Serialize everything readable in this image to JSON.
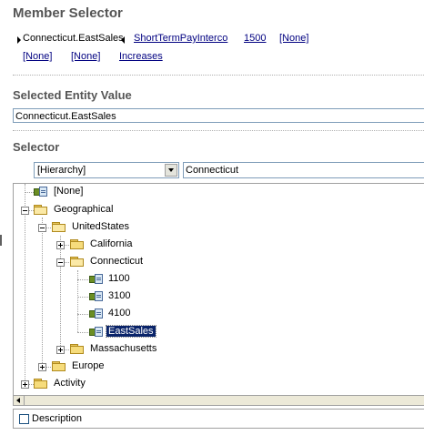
{
  "member_selector": {
    "title": "Member Selector",
    "pov_row1": [
      "Connecticut.EastSales",
      "ShortTermPayInterco",
      "1500",
      "[None]"
    ],
    "pov_row2": [
      "[None]",
      "[None]",
      "Increases"
    ]
  },
  "selected_entity": {
    "title": "Selected Entity Value",
    "value": "Connecticut.EastSales"
  },
  "selector": {
    "title": "Selector",
    "dropdown_value": "[Hierarchy]",
    "search_value": "Connecticut"
  },
  "tree": {
    "nodes": [
      {
        "label": "[None]",
        "type": "member"
      },
      {
        "label": "Geographical",
        "type": "folder-open",
        "state": "expanded"
      },
      {
        "label": "UnitedStates",
        "type": "folder-open",
        "state": "expanded"
      },
      {
        "label": "California",
        "type": "folder",
        "state": "collapsed"
      },
      {
        "label": "Connecticut",
        "type": "folder-open",
        "state": "expanded"
      },
      {
        "label": "1100",
        "type": "member"
      },
      {
        "label": "3100",
        "type": "member"
      },
      {
        "label": "4100",
        "type": "member"
      },
      {
        "label": "EastSales",
        "type": "member",
        "selected": true
      },
      {
        "label": "Massachusetts",
        "type": "folder",
        "state": "collapsed"
      },
      {
        "label": "Europe",
        "type": "folder",
        "state": "collapsed"
      },
      {
        "label": "Activity",
        "type": "folder",
        "state": "collapsed"
      }
    ]
  },
  "description": {
    "label": "Description",
    "checked": false
  },
  "colors": {
    "selection_bg": "#0a246a",
    "link": "#000080",
    "heading": "#555555"
  }
}
